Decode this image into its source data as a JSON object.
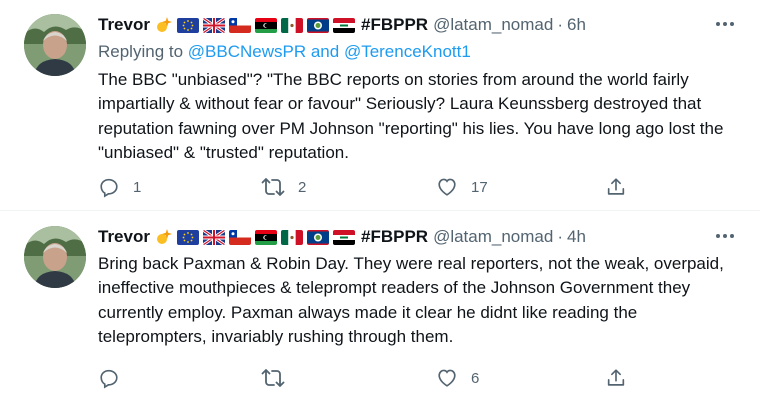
{
  "tweets": [
    {
      "name": "Trevor",
      "hashtag": "#FBPPR",
      "handle": "@latam_nomad",
      "separator": "·",
      "time": "6h",
      "replying_prefix": "Replying to ",
      "replying_to_1": "@BBCNewsPR",
      "replying_and": " and ",
      "replying_to_2": "@TerenceKnott1",
      "text": "The BBC \"unbiased\"? \"The BBC reports on stories from around the world fairly impartially & without fear or favour\" Seriously? Laura Keunssberg destroyed that reputation fawning over PM Johnson \"reporting\" his lies. You have long ago lost the \"unbiased\" & \"trusted\" reputation.",
      "reply_count": "1",
      "retweet_count": "2",
      "like_count": "17"
    },
    {
      "name": "Trevor",
      "hashtag": "#FBPPR",
      "handle": "@latam_nomad",
      "separator": "·",
      "time": "4h",
      "text": "Bring back Paxman & Robin Day. They were real reporters, not the weak, overpaid, ineffective mouthpieces & teleprompt readers of the Johnson Government they currently employ. Paxman always made it clear he didnt like reading the teleprompters, invariably rushing through them.",
      "reply_count": "",
      "retweet_count": "",
      "like_count": "6"
    }
  ],
  "icons": {
    "badges": [
      "sparkle-emoji",
      "eu-flag",
      "uk-flag",
      "chile-flag",
      "libya-flag",
      "mexico-flag",
      "belize-flag",
      "iraq-flag"
    ],
    "actions": [
      "reply-icon",
      "retweet-icon",
      "like-icon",
      "share-icon",
      "more-icon"
    ]
  },
  "colors": {
    "link": "#1d9bf0",
    "muted": "#536471",
    "text": "#0f1419"
  }
}
